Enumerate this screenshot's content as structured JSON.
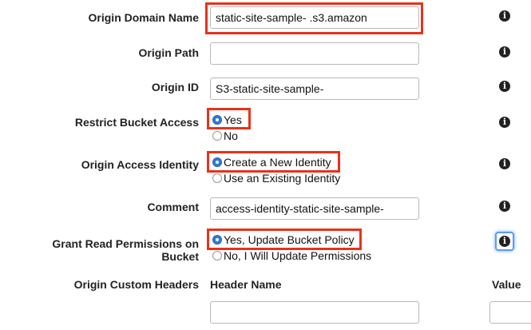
{
  "form": {
    "origin_domain_name": {
      "label": "Origin Domain Name",
      "value": "static-site-sample-             .s3.amazon"
    },
    "origin_path": {
      "label": "Origin Path",
      "value": ""
    },
    "origin_id": {
      "label": "Origin ID",
      "value": "S3-static-site-sample-"
    },
    "restrict_bucket_access": {
      "label": "Restrict Bucket Access",
      "options": [
        "Yes",
        "No"
      ],
      "selected": "Yes"
    },
    "origin_access_identity": {
      "label": "Origin Access Identity",
      "options": [
        "Create a New Identity",
        "Use an Existing Identity"
      ],
      "selected": "Create a New Identity"
    },
    "comment": {
      "label": "Comment",
      "value": "access-identity-static-site-sample-"
    },
    "grant_read_permissions": {
      "label_line1": "Grant Read Permissions on",
      "label_line2": "Bucket",
      "options": [
        "Yes, Update Bucket Policy",
        "No, I Will Update Permissions"
      ],
      "selected": "Yes, Update Bucket Policy"
    },
    "origin_custom_headers": {
      "label": "Origin Custom Headers",
      "header_name_label": "Header Name",
      "value_label": "Value"
    }
  },
  "info_icon": {
    "glyph": "i",
    "icon": "info-icon"
  },
  "colors": {
    "highlight": "#e8321a",
    "radio_selected": "#2f7ad6",
    "focus_ring": "#5b9bf0"
  }
}
